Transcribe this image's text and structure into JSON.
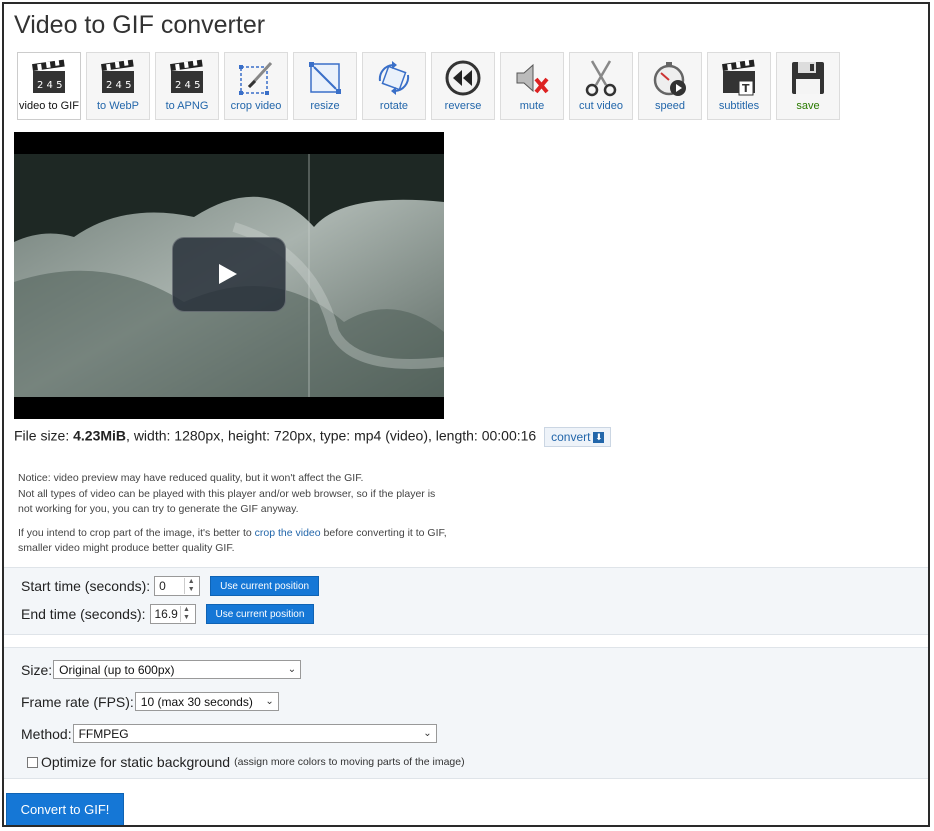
{
  "page": {
    "title": "Video to GIF converter"
  },
  "toolbar": {
    "items": [
      {
        "label": "video to GIF",
        "icon": "clapperboard-icon"
      },
      {
        "label": "to WebP",
        "icon": "clapperboard-icon"
      },
      {
        "label": "to APNG",
        "icon": "clapperboard-icon"
      },
      {
        "label": "crop video",
        "icon": "crop-icon"
      },
      {
        "label": "resize",
        "icon": "resize-icon"
      },
      {
        "label": "rotate",
        "icon": "rotate-icon"
      },
      {
        "label": "reverse",
        "icon": "rewind-icon"
      },
      {
        "label": "mute",
        "icon": "mute-icon"
      },
      {
        "label": "cut video",
        "icon": "scissors-icon"
      },
      {
        "label": "speed",
        "icon": "stopwatch-icon"
      },
      {
        "label": "subtitles",
        "icon": "subtitles-icon"
      },
      {
        "label": "save",
        "icon": "floppy-disk-icon"
      }
    ]
  },
  "file_info": {
    "prefix": "File size: ",
    "size": "4.23MiB",
    "rest": ", width: 1280px, height: 720px, type: mp4 (video), length: 00:00:16",
    "convert_label": "convert"
  },
  "notice": {
    "line1": "Notice: video preview may have reduced quality, but it won't affect the GIF.",
    "line2": "Not all types of video can be played with this player and/or web browser, so if the player is",
    "line3": "not working for you, you can try to generate the GIF anyway.",
    "crop_before": "If you intend to crop part of the image, it's better to ",
    "crop_link": "crop the video",
    "crop_after": " before converting it to GIF,",
    "crop_line2": "smaller video might produce better quality GIF."
  },
  "time": {
    "start_label": "Start time (seconds):",
    "start_value": "0",
    "end_label": "End time (seconds):",
    "end_value": "16.9",
    "use_current": "Use current position"
  },
  "options": {
    "size_label": "Size:",
    "size_value": "Original (up to 600px)",
    "fps_label": "Frame rate (FPS):",
    "fps_value": "10 (max 30 seconds)",
    "method_label": "Method:",
    "method_value": "FFMPEG",
    "optimize_label": "Optimize for static background",
    "optimize_note": "(assign more colors to moving parts of the image)",
    "optimize_checked": false
  },
  "actions": {
    "convert_label": "Convert to GIF!"
  }
}
